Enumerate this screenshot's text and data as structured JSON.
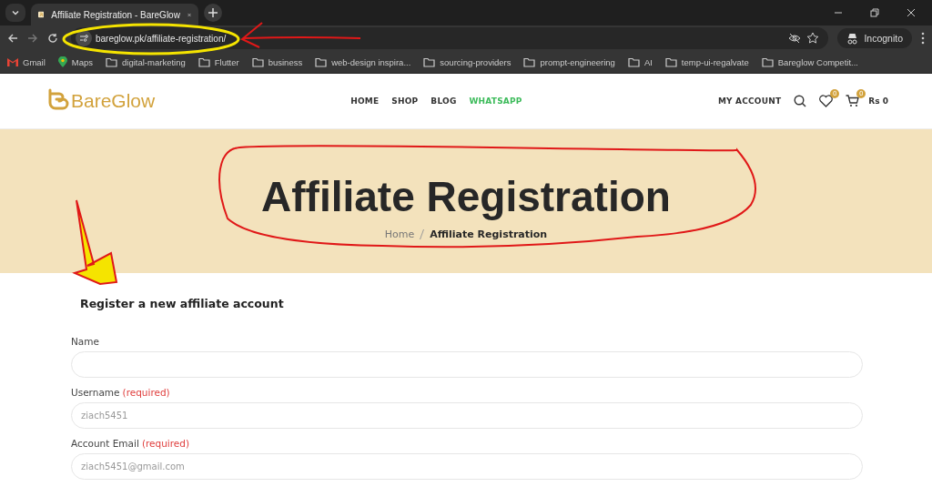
{
  "browser": {
    "tab": {
      "title": "Affiliate Registration - BareGlow",
      "selected": true
    },
    "url": "bareglow.pk/affiliate-registration/",
    "profile": "Incognito",
    "bookmarks": [
      {
        "kind": "gmail",
        "label": "Gmail"
      },
      {
        "kind": "maps",
        "label": "Maps"
      },
      {
        "kind": "folder",
        "label": "digital-marketing"
      },
      {
        "kind": "folder",
        "label": "Flutter"
      },
      {
        "kind": "folder",
        "label": "business"
      },
      {
        "kind": "folder",
        "label": "web-design inspira..."
      },
      {
        "kind": "folder",
        "label": "sourcing-providers"
      },
      {
        "kind": "folder",
        "label": "prompt-engineering"
      },
      {
        "kind": "folder",
        "label": "AI"
      },
      {
        "kind": "folder",
        "label": "temp-ui-regalvate"
      },
      {
        "kind": "folder",
        "label": "Bareglow Competit..."
      }
    ]
  },
  "site": {
    "logo": "BareGlow",
    "nav": [
      {
        "label": "HOME",
        "highlight": false
      },
      {
        "label": "SHOP",
        "highlight": false
      },
      {
        "label": "BLOG",
        "highlight": false
      },
      {
        "label": "WHATSAPP",
        "highlight": true
      }
    ],
    "account": "MY ACCOUNT",
    "wishlist_count": "0",
    "cart_count": "0",
    "cart_total": "Rs 0"
  },
  "hero": {
    "title": "Affiliate Registration",
    "breadcrumb": [
      {
        "label": "Home",
        "current": false
      },
      {
        "label": "Affiliate Registration",
        "current": true
      }
    ]
  },
  "form": {
    "heading": "Register a new affiliate account",
    "fields": [
      {
        "label": "Name"
      },
      {
        "label": "Username",
        "required": "(required)",
        "value": "ziach5451"
      },
      {
        "label": "Account Email",
        "required": "(required)",
        "value": "ziach5451@gmail.com"
      }
    ]
  }
}
